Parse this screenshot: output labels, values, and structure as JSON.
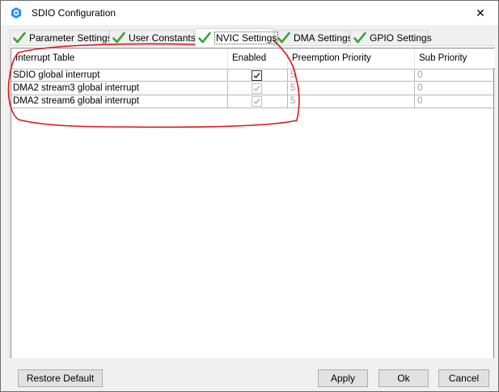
{
  "window": {
    "title": "SDIO Configuration",
    "close_glyph": "✕"
  },
  "tabs": [
    {
      "label": "Parameter Settings",
      "active": false
    },
    {
      "label": "User Constants",
      "active": false
    },
    {
      "label": "NVIC Settings",
      "active": true
    },
    {
      "label": "DMA Settings",
      "active": false
    },
    {
      "label": "GPIO Settings",
      "active": false
    }
  ],
  "table": {
    "headers": [
      "Interrupt Table",
      "Enabled",
      "Preemption Priority",
      "Sub Priority"
    ],
    "rows": [
      {
        "name": "SDIO global interrupt",
        "enabled": true,
        "enabled_editable": true,
        "preemption": "5",
        "sub": "0"
      },
      {
        "name": "DMA2 stream3 global interrupt",
        "enabled": true,
        "enabled_editable": false,
        "preemption": "5",
        "sub": "0"
      },
      {
        "name": "DMA2 stream6 global interrupt",
        "enabled": true,
        "enabled_editable": false,
        "preemption": "5",
        "sub": "0"
      }
    ]
  },
  "buttons": {
    "restore_default": "Restore Default",
    "apply": "Apply",
    "ok": "Ok",
    "cancel": "Cancel"
  },
  "colors": {
    "check_green": "#3aa33a",
    "annotation_red": "#e0141c",
    "title_icon_blue": "#1e90ff"
  },
  "icons": {
    "title": "stm32cube-icon",
    "tab": "green-check-icon",
    "close": "close-icon"
  }
}
